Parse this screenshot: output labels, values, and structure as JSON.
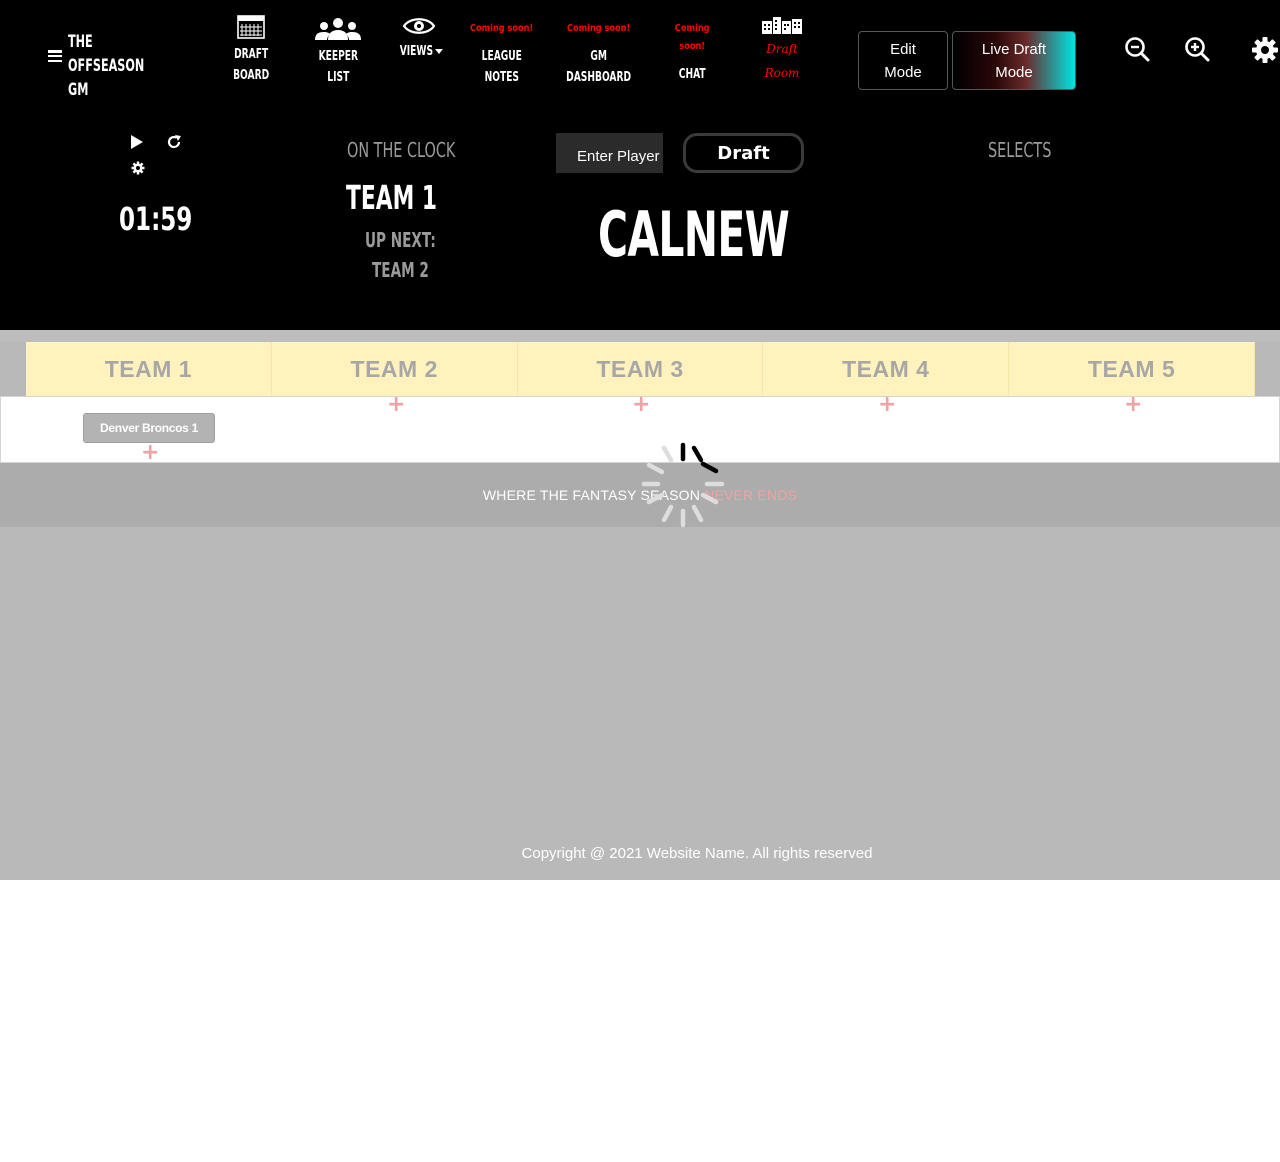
{
  "brand": {
    "name": "THE\nOFFSEASON\nGM"
  },
  "nav": {
    "draft_board": "DRAFT\nBOARD",
    "keeper_list": "KEEPER\nLIST",
    "views": "VIEWS",
    "league_notes": {
      "badge": "Coming soon!",
      "label": "LEAGUE\nNOTES"
    },
    "gm_dashboard": {
      "badge": "Coming soon!",
      "label": "GM\nDASHBOARD"
    },
    "chat": {
      "badge": "Coming\nsoon!",
      "label": "CHAT"
    },
    "draft_room": "Draft\nRoom"
  },
  "modes": {
    "edit": "Edit\nMode",
    "live": "Live Draft\nMode"
  },
  "clock": {
    "timer": "01:59",
    "on_the_clock_label": "ON THE CLOCK",
    "on_the_clock_team": "TEAM 1",
    "up_next_label": "UP NEXT:",
    "up_next_team": "TEAM 2"
  },
  "draft": {
    "input_placeholder": "Enter Player",
    "button_label": "Draft",
    "current_player": "CALNEW",
    "selects_label": "SELECTS"
  },
  "board": {
    "teams": [
      "TEAM 1",
      "TEAM 2",
      "TEAM 3",
      "TEAM 4",
      "TEAM 5"
    ],
    "picks": [
      {
        "team": "TEAM 1",
        "label": "Denver Broncos 1"
      }
    ]
  },
  "footer": {
    "tagline_white": "WHERE THE FANTASY SEASON",
    "tagline_pink": "NEVER ENDS",
    "copyright": "Copyright @ 2021 Website Name. All rights reserved"
  },
  "colors": {
    "accent_red": "#ff0000",
    "header_yellow": "#fff2bd",
    "plus_pink": "#f2a2a2",
    "live_gradient_end": "#00e5e5"
  }
}
